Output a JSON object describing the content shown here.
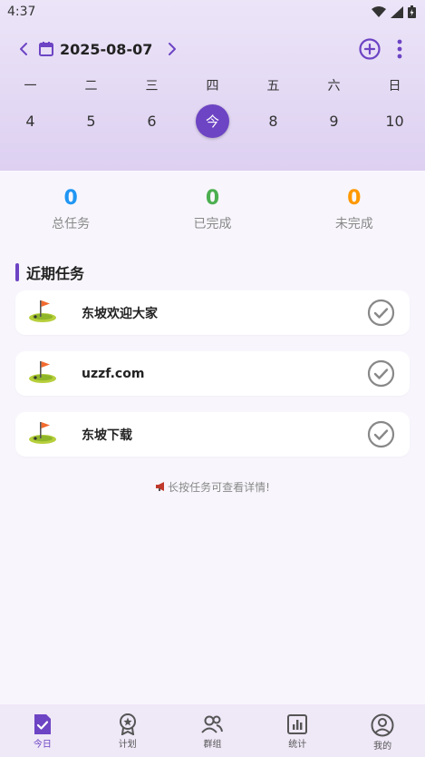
{
  "status": {
    "time": "4:37"
  },
  "header": {
    "date": "2025-08-07"
  },
  "week": {
    "days": [
      "一",
      "二",
      "三",
      "四",
      "五",
      "六",
      "日"
    ],
    "nums": [
      "4",
      "5",
      "6",
      "今",
      "8",
      "9",
      "10"
    ]
  },
  "stats": [
    {
      "value": "0",
      "label": "总任务",
      "color": "#2196f3"
    },
    {
      "value": "0",
      "label": "已完成",
      "color": "#4caf50"
    },
    {
      "value": "0",
      "label": "未完成",
      "color": "#ff9800"
    }
  ],
  "section": {
    "title": "近期任务"
  },
  "tasks": [
    {
      "title": "东坡欢迎大家",
      "icon": "golf-flag-icon"
    },
    {
      "title": "uzzf.com",
      "icon": "golf-flag-icon"
    },
    {
      "title": "东坡下载",
      "icon": "golf-flag-icon"
    }
  ],
  "hint": "长按任务可查看详情!",
  "nav": [
    {
      "label": "今日",
      "icon": "today-check-icon"
    },
    {
      "label": "计划",
      "icon": "badge-star-icon"
    },
    {
      "label": "群组",
      "icon": "group-icon"
    },
    {
      "label": "统计",
      "icon": "bar-chart-icon"
    },
    {
      "label": "我的",
      "icon": "profile-icon"
    }
  ],
  "colors": {
    "accent": "#6d44c4"
  }
}
